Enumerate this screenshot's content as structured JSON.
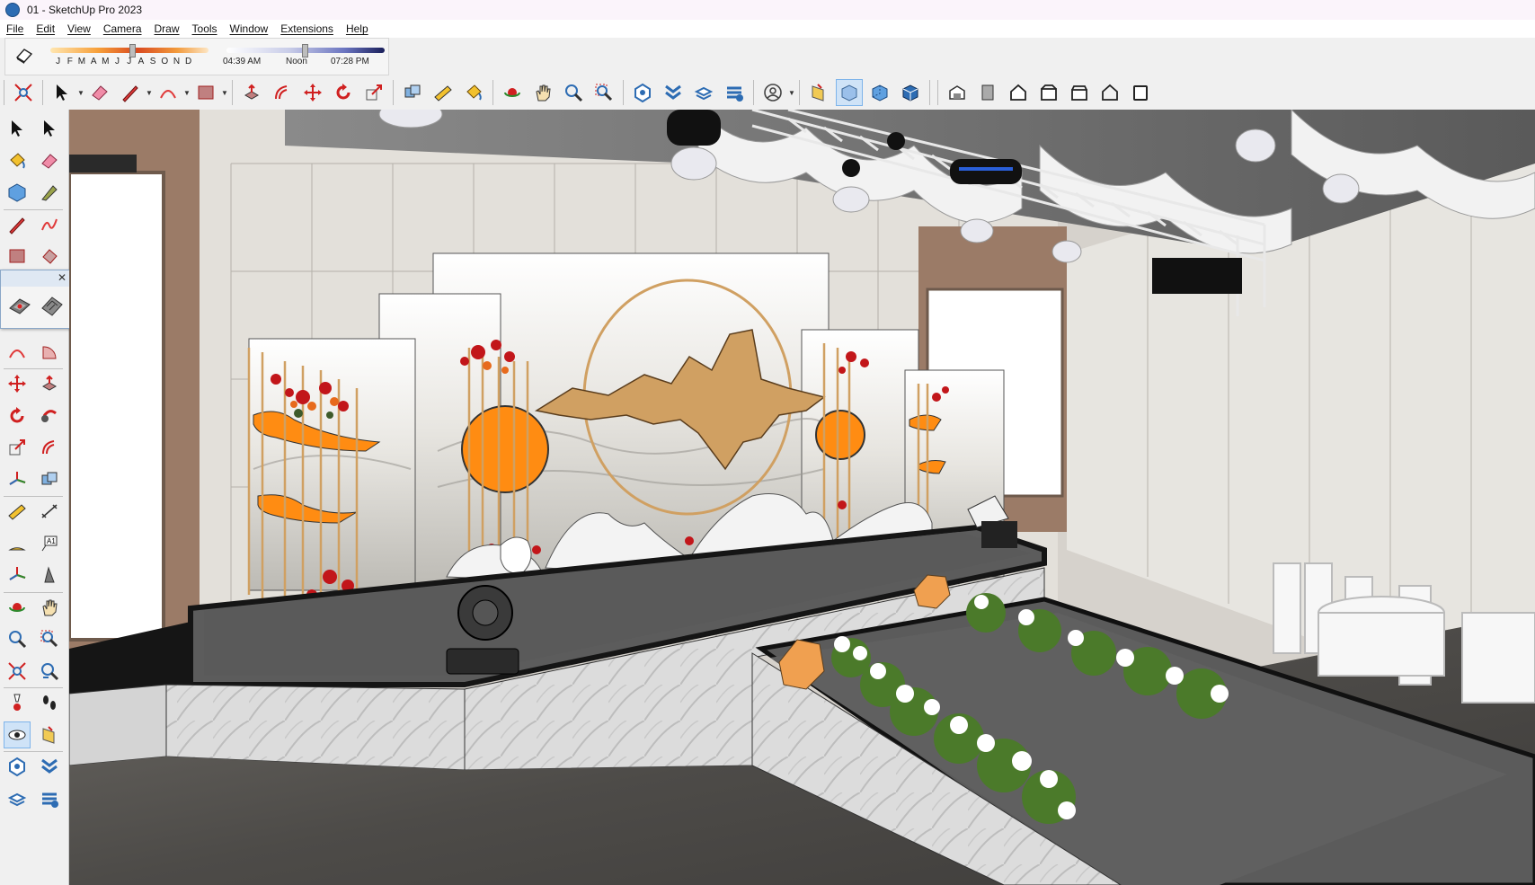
{
  "window": {
    "title": "01 - SketchUp Pro 2023"
  },
  "menu": [
    "File",
    "Edit",
    "View",
    "Camera",
    "Draw",
    "Tools",
    "Window",
    "Extensions",
    "Help"
  ],
  "shadows": {
    "months": [
      "J",
      "F",
      "M",
      "A",
      "M",
      "J",
      "J",
      "A",
      "S",
      "O",
      "N",
      "D"
    ],
    "sunrise": "04:39 AM",
    "noon": "Noon",
    "sunset": "07:28 PM",
    "date_position": 0.5,
    "time_position": 0.48
  },
  "main_toolbar": [
    {
      "name": "zoom-extents-tool-icon"
    },
    {
      "name": "select-tool-icon",
      "dropdown": true
    },
    {
      "name": "eraser-tool-icon"
    },
    {
      "name": "line-tool-icon",
      "dropdown": true
    },
    {
      "name": "arc-tool-icon",
      "dropdown": true
    },
    {
      "name": "rectangle-tool-icon",
      "dropdown": true
    },
    {
      "name": "push-pull-tool-icon"
    },
    {
      "name": "offset-tool-icon"
    },
    {
      "name": "move-tool-icon"
    },
    {
      "name": "rotate-tool-icon"
    },
    {
      "name": "scale-tool-icon"
    },
    {
      "name": "solid-tools-icon"
    },
    {
      "name": "tape-measure-tool-icon"
    },
    {
      "name": "paint-bucket-tool-icon"
    },
    {
      "name": "orbit-tool-icon"
    },
    {
      "name": "pan-tool-icon"
    },
    {
      "name": "zoom-tool-icon"
    },
    {
      "name": "zoom-window-icon"
    },
    {
      "name": "warehouse-icon"
    },
    {
      "name": "extension-warehouse-icon"
    },
    {
      "name": "layout-send-icon"
    },
    {
      "name": "extension-manager-icon"
    },
    {
      "name": "account-icon",
      "dropdown": true
    }
  ],
  "view_toolbar": [
    {
      "name": "section-plane-icon"
    },
    {
      "name": "xray-view-icon",
      "active": true
    },
    {
      "name": "back-edges-view-icon"
    },
    {
      "name": "wireframe-view-icon"
    }
  ],
  "camera_toolbar": [
    {
      "name": "iso-view-icon"
    },
    {
      "name": "top-view-icon"
    },
    {
      "name": "front-view-icon"
    },
    {
      "name": "right-view-icon"
    },
    {
      "name": "back-view-icon"
    },
    {
      "name": "left-view-icon"
    },
    {
      "name": "bottom-view-icon"
    }
  ],
  "left_toolbar": [
    [
      "select-arrow-icon",
      "lasso-select-icon"
    ],
    [
      "paint-bucket-icon",
      "eraser-icon"
    ],
    [
      "component-icon",
      "tag-tool-icon"
    ],
    [
      "pencil-line-icon",
      "freehand-icon"
    ],
    [
      "rectangle-icon",
      "rotated-rectangle-icon"
    ],
    [
      "circle-icon",
      "polygon-icon"
    ],
    [
      "arc-icon",
      "two-point-arc-icon"
    ],
    [
      "three-point-arc-icon",
      "pie-icon"
    ],
    [
      "move-icon",
      "push-pull-icon"
    ],
    [
      "rotate-icon",
      "follow-me-icon"
    ],
    [
      "scale-icon",
      "offset-icon"
    ],
    [
      "axes-icon",
      "solid-tools-icon"
    ],
    [
      "tape-measure-icon",
      "dimension-icon"
    ],
    [
      "protractor-icon",
      "text-icon"
    ],
    [
      "axes-tool-icon",
      "three-d-text-icon"
    ],
    [
      "orbit-icon",
      "pan-icon"
    ],
    [
      "zoom-icon",
      "zoom-window-icon"
    ],
    [
      "zoom-extents-icon",
      "previous-view-icon"
    ],
    [
      "position-camera-icon",
      "walk-icon"
    ],
    [
      "look-around-icon",
      "section-icon"
    ],
    [
      "warehouse-icon",
      "extension-warehouse-icon"
    ],
    [
      "layout-icon",
      "extension-manager-icon"
    ]
  ],
  "colors": {
    "orange": "#ff8c12",
    "gold": "#d0a062",
    "stage_top": "#5c5c5c",
    "stage_trim": "#151515",
    "floor": "#4c4a47",
    "wall": "#e9e7e2",
    "wood": "#9b7b67",
    "accent_blue": "#7eb4ea"
  }
}
